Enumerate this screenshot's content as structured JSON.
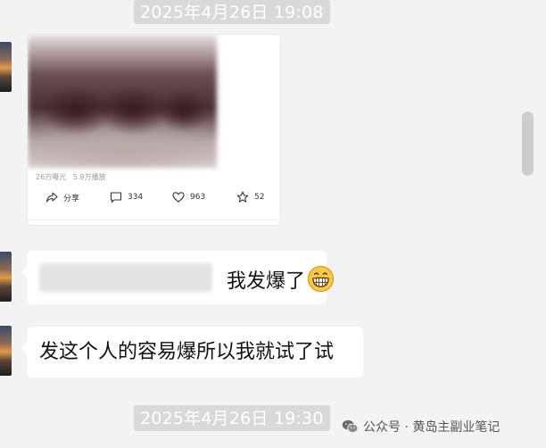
{
  "timestamps": [
    "2025年4月26日 19:08",
    "2025年4月26日 19:30"
  ],
  "shared_card": {
    "stats": [
      "26万曝光",
      "5.9万播放"
    ],
    "actions": {
      "share": "分享",
      "comments": "334",
      "likes": "963",
      "favorites": "52"
    }
  },
  "messages": [
    {
      "text": "我发爆了",
      "emoji": "grinning-face-emoji"
    },
    {
      "text": "发这个人的容易爆所以我就试了试"
    }
  ],
  "watermark": {
    "text": "公众号 · 黄岛主副业笔记",
    "icon": "wechat-icon"
  },
  "colors": {
    "background": "#f3f3f3",
    "bubble": "#ffffff",
    "timestamp_bg": "#d9d9d9"
  }
}
